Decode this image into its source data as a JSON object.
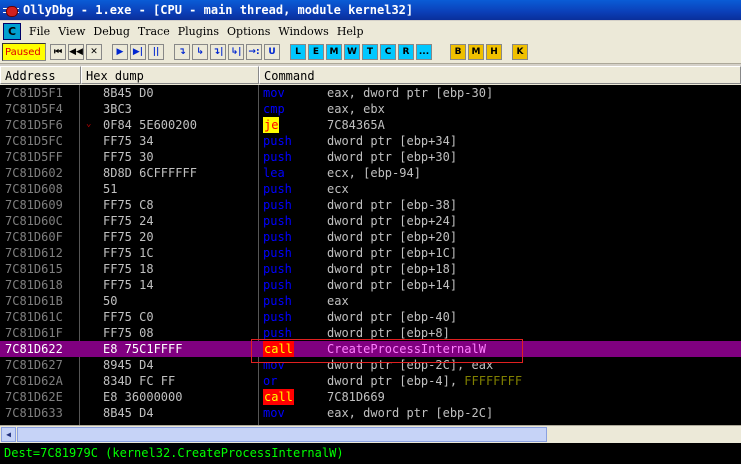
{
  "window": {
    "title": "OllyDbg - 1.exe - [CPU - main thread, module kernel32]"
  },
  "menu": {
    "items": [
      "File",
      "View",
      "Debug",
      "Trace",
      "Plugins",
      "Options",
      "Windows",
      "Help"
    ],
    "c_button": "C"
  },
  "toolbar": {
    "status": "Paused",
    "buttons1": [
      "⏮",
      "◀◀",
      "✕"
    ],
    "buttons2": [
      "▶",
      "▶|",
      "||"
    ],
    "buttons3": [
      "↴",
      "↳",
      "↴|",
      "↳|"
    ],
    "buttons4": [
      "→:",
      "U"
    ],
    "window_buttons": [
      "L",
      "E",
      "M",
      "W",
      "T",
      "C",
      "R",
      "..."
    ],
    "extra_buttons": [
      "B",
      "M",
      "H"
    ],
    "k_button": "K"
  },
  "columns": {
    "address": "Address",
    "hex": "Hex dump",
    "command": "Command"
  },
  "rows": [
    {
      "addr": "7C81D5F1",
      "hex": "8B45 D0",
      "mn": "mov",
      "op": "eax, dword ptr [ebp-30]",
      "style": "plain"
    },
    {
      "addr": "7C81D5F4",
      "hex": "3BC3",
      "mn": "cmp",
      "op": "eax, ebx",
      "style": "plain"
    },
    {
      "addr": "7C81D5F6",
      "hex": "0F84 5E600200",
      "mn": "je",
      "op": "7C84365A",
      "style": "je",
      "jump": true
    },
    {
      "addr": "7C81D5FC",
      "hex": "FF75 34",
      "mn": "push",
      "op": "dword ptr [ebp+34]",
      "style": "push"
    },
    {
      "addr": "7C81D5FF",
      "hex": "FF75 30",
      "mn": "push",
      "op": "dword ptr [ebp+30]",
      "style": "push"
    },
    {
      "addr": "7C81D602",
      "hex": "8D8D 6CFFFFFF",
      "mn": "lea",
      "op": "ecx, [ebp-94]",
      "style": "plain"
    },
    {
      "addr": "7C81D608",
      "hex": "51",
      "mn": "push",
      "op": "ecx",
      "style": "push"
    },
    {
      "addr": "7C81D609",
      "hex": "FF75 C8",
      "mn": "push",
      "op": "dword ptr [ebp-38]",
      "style": "push"
    },
    {
      "addr": "7C81D60C",
      "hex": "FF75 24",
      "mn": "push",
      "op": "dword ptr [ebp+24]",
      "style": "push"
    },
    {
      "addr": "7C81D60F",
      "hex": "FF75 20",
      "mn": "push",
      "op": "dword ptr [ebp+20]",
      "style": "push"
    },
    {
      "addr": "7C81D612",
      "hex": "FF75 1C",
      "mn": "push",
      "op": "dword ptr [ebp+1C]",
      "style": "push"
    },
    {
      "addr": "7C81D615",
      "hex": "FF75 18",
      "mn": "push",
      "op": "dword ptr [ebp+18]",
      "style": "push"
    },
    {
      "addr": "7C81D618",
      "hex": "FF75 14",
      "mn": "push",
      "op": "dword ptr [ebp+14]",
      "style": "push"
    },
    {
      "addr": "7C81D61B",
      "hex": "50",
      "mn": "push",
      "op": "eax",
      "style": "push"
    },
    {
      "addr": "7C81D61C",
      "hex": "FF75 C0",
      "mn": "push",
      "op": "dword ptr [ebp-40]",
      "style": "push"
    },
    {
      "addr": "7C81D61F",
      "hex": "FF75 08",
      "mn": "push",
      "op": "dword ptr [ebp+8]",
      "style": "push"
    },
    {
      "addr": "7C81D622",
      "hex": "E8 75C1FFFF",
      "mn": "call",
      "op": "CreateProcessInternalW",
      "style": "call",
      "selected": true
    },
    {
      "addr": "7C81D627",
      "hex": "8945 D4",
      "mn": "mov",
      "op": "dword ptr [ebp-2C], eax",
      "style": "plain"
    },
    {
      "addr": "7C81D62A",
      "hex": "834D FC FF",
      "mn": "or",
      "op": "dword ptr [ebp-4], ",
      "op_extra": "FFFFFFFF",
      "style": "plain"
    },
    {
      "addr": "7C81D62E",
      "hex": "E8 36000000",
      "mn": "call",
      "op": "7C81D669",
      "style": "call"
    },
    {
      "addr": "7C81D633",
      "hex": "8B45 D4",
      "mn": "mov",
      "op": "eax, dword ptr [ebp-2C]",
      "style": "plain"
    }
  ],
  "info": {
    "text": "Dest=7C81979C (kernel32.CreateProcessInternalW)"
  }
}
